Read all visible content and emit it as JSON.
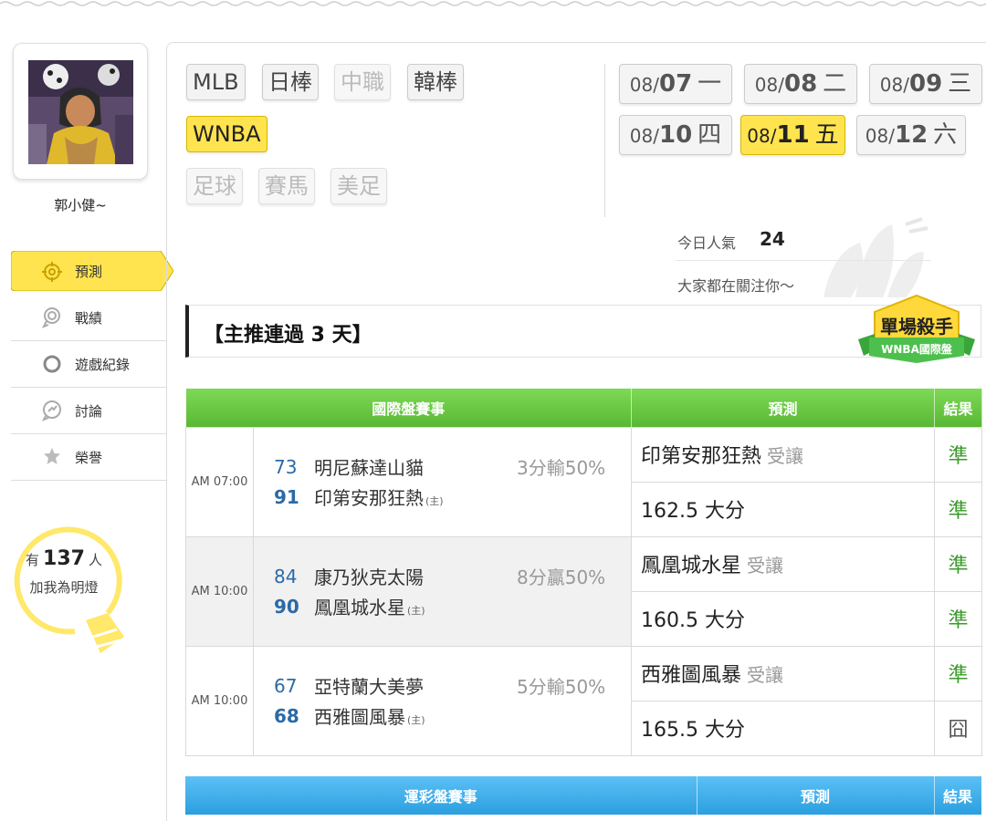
{
  "user": {
    "name": "郭小健~"
  },
  "sidebar": {
    "items": [
      {
        "label": "預測",
        "icon": "target-icon",
        "active": true
      },
      {
        "label": "戰績",
        "icon": "medal-icon",
        "active": false
      },
      {
        "label": "遊戲紀錄",
        "icon": "circle-icon",
        "active": false
      },
      {
        "label": "討論",
        "icon": "chat-icon",
        "active": false
      },
      {
        "label": "榮譽",
        "icon": "trophy-icon",
        "active": false
      }
    ],
    "lamp": {
      "prefix": "有",
      "count": "137",
      "suffix": "人",
      "line2": "加我為明燈"
    }
  },
  "leagues": [
    {
      "label": "MLB",
      "state": "normal"
    },
    {
      "label": "日棒",
      "state": "normal"
    },
    {
      "label": "中職",
      "state": "disabled"
    },
    {
      "label": "韓棒",
      "state": "normal"
    },
    {
      "label": "WNBA",
      "state": "active"
    },
    {
      "label": "足球",
      "state": "disabled"
    },
    {
      "label": "賽馬",
      "state": "disabled"
    },
    {
      "label": "美足",
      "state": "disabled"
    }
  ],
  "dates": [
    {
      "month": "08/",
      "day": "07",
      "weekday": "一",
      "active": false
    },
    {
      "month": "08/",
      "day": "08",
      "weekday": "二",
      "active": false
    },
    {
      "month": "08/",
      "day": "09",
      "weekday": "三",
      "active": false
    },
    {
      "month": "08/",
      "day": "10",
      "weekday": "四",
      "active": false
    },
    {
      "month": "08/",
      "day": "11",
      "weekday": "五",
      "active": true
    },
    {
      "month": "08/",
      "day": "12",
      "weekday": "六",
      "active": false
    }
  ],
  "popularity": {
    "label": "今日人氣",
    "count": "24",
    "message": "大家都在關注你～"
  },
  "streak": "【主推連過 3 天】",
  "badge": {
    "title": "單場殺手",
    "subtitle": "WNBA國際盤"
  },
  "intl_table": {
    "headers": {
      "match": "國際盤賽事",
      "prediction": "預測",
      "result": "結果"
    },
    "games": [
      {
        "time": "AM 07:00",
        "away": {
          "score": "73",
          "team": "明尼蘇達山貓"
        },
        "home": {
          "score": "91",
          "team": "印第安那狂熱",
          "tag": "(主)"
        },
        "spread": "3分輸50%",
        "pred1": {
          "text": "印第安那狂熱",
          "tag": "受讓",
          "result": "準"
        },
        "pred2": {
          "text": "162.5 大分",
          "result": "準"
        }
      },
      {
        "time": "AM 10:00",
        "away": {
          "score": "84",
          "team": "康乃狄克太陽"
        },
        "home": {
          "score": "90",
          "team": "鳳凰城水星",
          "tag": "(主)"
        },
        "spread": "8分贏50%",
        "pred1": {
          "text": "鳳凰城水星",
          "tag": "受讓",
          "result": "準"
        },
        "pred2": {
          "text": "160.5 大分",
          "result": "準"
        }
      },
      {
        "time": "AM 10:00",
        "away": {
          "score": "67",
          "team": "亞特蘭大美夢"
        },
        "home": {
          "score": "68",
          "team": "西雅圖風暴",
          "tag": "(主)"
        },
        "spread": "5分輸50%",
        "pred1": {
          "text": "西雅圖風暴",
          "tag": "受讓",
          "result": "準"
        },
        "pred2": {
          "text": "165.5 大分",
          "result": "囧"
        }
      }
    ]
  },
  "sport_table": {
    "headers": {
      "match": "運彩盤賽事",
      "prediction": "預測",
      "result": "結果"
    }
  },
  "colors": {
    "accent_yellow": "#ffe44f",
    "header_green": "#6cc947",
    "header_blue": "#3aabea",
    "win_green": "#3a9b2a",
    "score_blue": "#2b6aa8"
  }
}
